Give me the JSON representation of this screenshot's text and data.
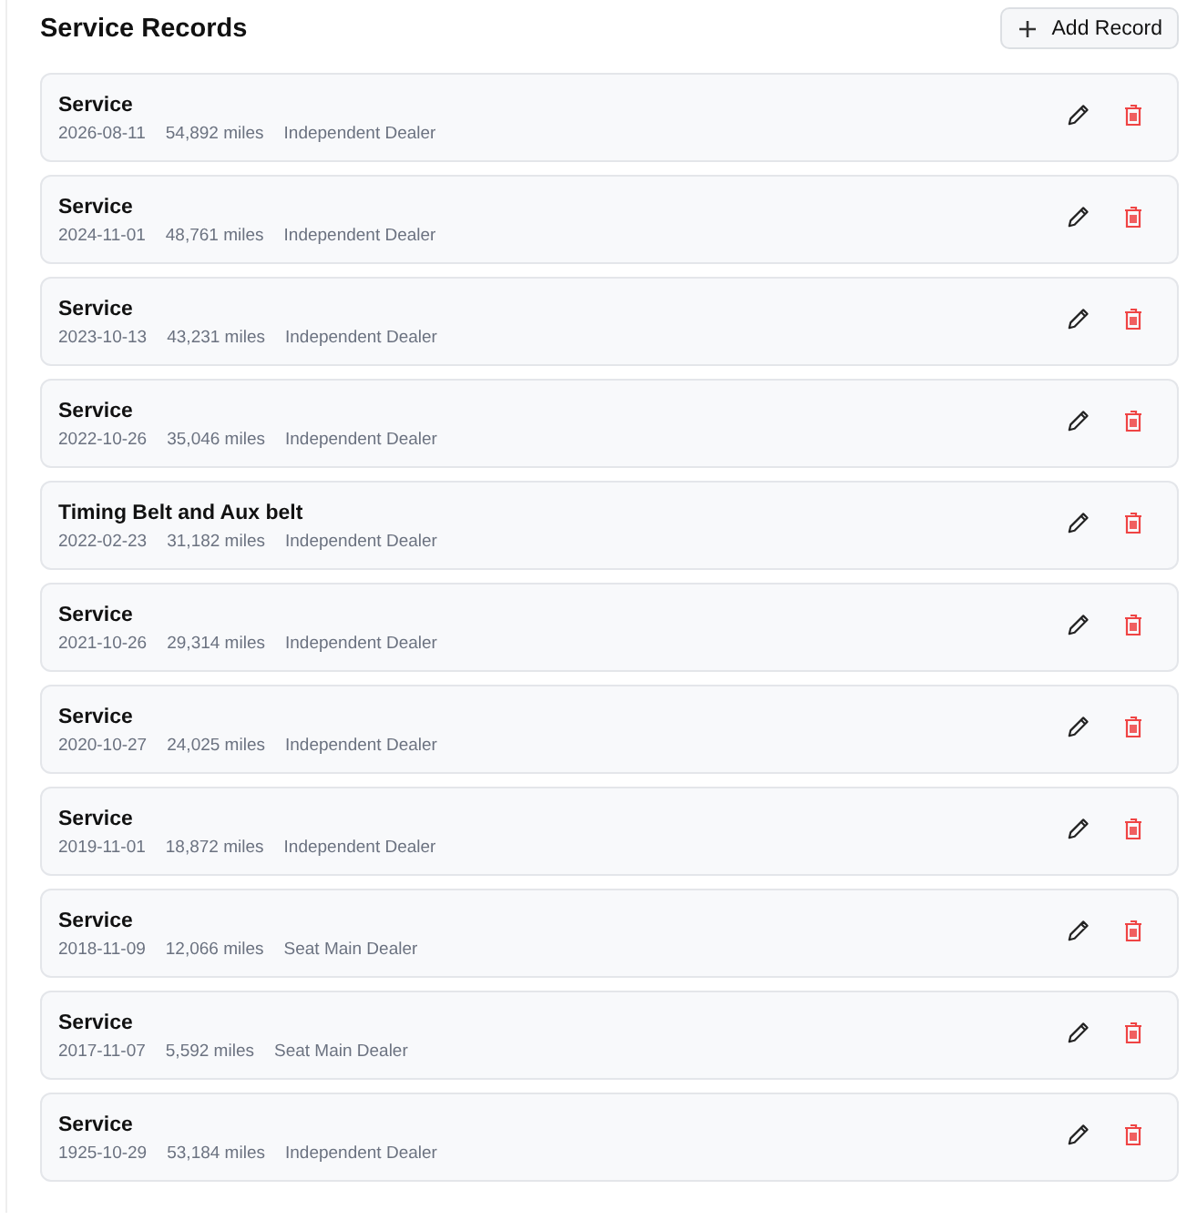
{
  "title": "Service Records",
  "add_button": {
    "label": "Add Record"
  },
  "records": [
    {
      "title": "Service",
      "date": "2026-08-11",
      "mileage": "54,892 miles",
      "dealer": "Independent Dealer"
    },
    {
      "title": "Service",
      "date": "2024-11-01",
      "mileage": "48,761 miles",
      "dealer": "Independent Dealer"
    },
    {
      "title": "Service",
      "date": "2023-10-13",
      "mileage": "43,231 miles",
      "dealer": "Independent Dealer"
    },
    {
      "title": "Service",
      "date": "2022-10-26",
      "mileage": "35,046 miles",
      "dealer": "Independent Dealer"
    },
    {
      "title": "Timing Belt and Aux belt",
      "date": "2022-02-23",
      "mileage": "31,182 miles",
      "dealer": "Independent Dealer"
    },
    {
      "title": "Service",
      "date": "2021-10-26",
      "mileage": "29,314 miles",
      "dealer": "Independent Dealer"
    },
    {
      "title": "Service",
      "date": "2020-10-27",
      "mileage": "24,025 miles",
      "dealer": "Independent Dealer"
    },
    {
      "title": "Service",
      "date": "2019-11-01",
      "mileage": "18,872 miles",
      "dealer": "Independent Dealer"
    },
    {
      "title": "Service",
      "date": "2018-11-09",
      "mileage": "12,066 miles",
      "dealer": "Seat Main Dealer"
    },
    {
      "title": "Service",
      "date": "2017-11-07",
      "mileage": "5,592 miles",
      "dealer": "Seat Main Dealer"
    },
    {
      "title": "Service",
      "date": "1925-10-29",
      "mileage": "53,184 miles",
      "dealer": "Independent Dealer"
    }
  ]
}
